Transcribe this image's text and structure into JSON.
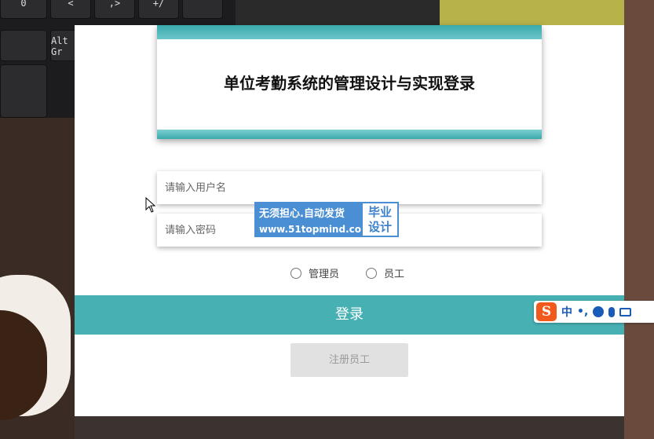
{
  "keyboard": {
    "keys": [
      "0",
      "<",
      ",>",
      "+/",
      "Alt Gr"
    ]
  },
  "form": {
    "title": "单位考勤系统的管理设计与实现登录",
    "username_placeholder": "请输入用户名",
    "password_placeholder": "请输入密码",
    "roles": [
      "管理员",
      "员工"
    ],
    "login_label": "登录",
    "register_label": "注册员工"
  },
  "watermark": {
    "line1": "无须担心.自动发货",
    "line2": "www.51topmind.com",
    "badge_line1": "毕业",
    "badge_line2": "设计"
  },
  "ime": {
    "logo": "S",
    "mode": "中",
    "punct": "•,"
  },
  "colors": {
    "accent": "#47b0b3",
    "watermark_blue": "#4a8fd4",
    "ime_logo": "#f25a1d"
  },
  "icons": [
    "sogou-logo-icon",
    "smiley-icon",
    "microphone-icon",
    "keyboard-icon",
    "mouse-cursor-icon"
  ]
}
